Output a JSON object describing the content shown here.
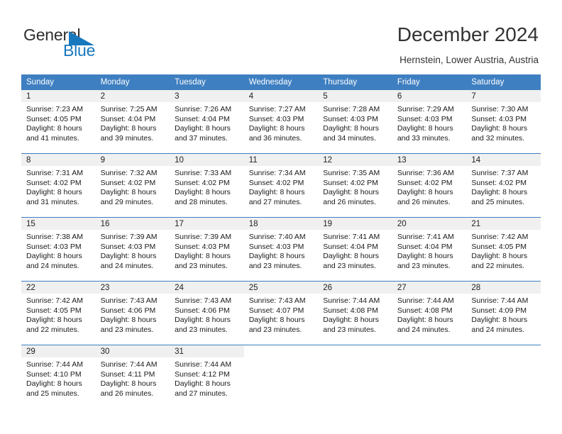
{
  "brand": {
    "name_part1": "General",
    "name_part2": "Blue",
    "triangle_color": "#1878be",
    "text_color": "#2e2e2e"
  },
  "header": {
    "title": "December 2024",
    "subtitle": "Hernstein, Lower Austria, Austria"
  },
  "calendar": {
    "header_bg": "#3e7fc1",
    "header_text_color": "#ffffff",
    "daynum_band_bg": "#f0f0f0",
    "weekday_headers": [
      "Sunday",
      "Monday",
      "Tuesday",
      "Wednesday",
      "Thursday",
      "Friday",
      "Saturday"
    ],
    "weeks": [
      [
        {
          "day": "1",
          "sunrise": "Sunrise: 7:23 AM",
          "sunset": "Sunset: 4:05 PM",
          "daylight_line1": "Daylight: 8 hours",
          "daylight_line2": "and 41 minutes."
        },
        {
          "day": "2",
          "sunrise": "Sunrise: 7:25 AM",
          "sunset": "Sunset: 4:04 PM",
          "daylight_line1": "Daylight: 8 hours",
          "daylight_line2": "and 39 minutes."
        },
        {
          "day": "3",
          "sunrise": "Sunrise: 7:26 AM",
          "sunset": "Sunset: 4:04 PM",
          "daylight_line1": "Daylight: 8 hours",
          "daylight_line2": "and 37 minutes."
        },
        {
          "day": "4",
          "sunrise": "Sunrise: 7:27 AM",
          "sunset": "Sunset: 4:03 PM",
          "daylight_line1": "Daylight: 8 hours",
          "daylight_line2": "and 36 minutes."
        },
        {
          "day": "5",
          "sunrise": "Sunrise: 7:28 AM",
          "sunset": "Sunset: 4:03 PM",
          "daylight_line1": "Daylight: 8 hours",
          "daylight_line2": "and 34 minutes."
        },
        {
          "day": "6",
          "sunrise": "Sunrise: 7:29 AM",
          "sunset": "Sunset: 4:03 PM",
          "daylight_line1": "Daylight: 8 hours",
          "daylight_line2": "and 33 minutes."
        },
        {
          "day": "7",
          "sunrise": "Sunrise: 7:30 AM",
          "sunset": "Sunset: 4:03 PM",
          "daylight_line1": "Daylight: 8 hours",
          "daylight_line2": "and 32 minutes."
        }
      ],
      [
        {
          "day": "8",
          "sunrise": "Sunrise: 7:31 AM",
          "sunset": "Sunset: 4:02 PM",
          "daylight_line1": "Daylight: 8 hours",
          "daylight_line2": "and 31 minutes."
        },
        {
          "day": "9",
          "sunrise": "Sunrise: 7:32 AM",
          "sunset": "Sunset: 4:02 PM",
          "daylight_line1": "Daylight: 8 hours",
          "daylight_line2": "and 29 minutes."
        },
        {
          "day": "10",
          "sunrise": "Sunrise: 7:33 AM",
          "sunset": "Sunset: 4:02 PM",
          "daylight_line1": "Daylight: 8 hours",
          "daylight_line2": "and 28 minutes."
        },
        {
          "day": "11",
          "sunrise": "Sunrise: 7:34 AM",
          "sunset": "Sunset: 4:02 PM",
          "daylight_line1": "Daylight: 8 hours",
          "daylight_line2": "and 27 minutes."
        },
        {
          "day": "12",
          "sunrise": "Sunrise: 7:35 AM",
          "sunset": "Sunset: 4:02 PM",
          "daylight_line1": "Daylight: 8 hours",
          "daylight_line2": "and 26 minutes."
        },
        {
          "day": "13",
          "sunrise": "Sunrise: 7:36 AM",
          "sunset": "Sunset: 4:02 PM",
          "daylight_line1": "Daylight: 8 hours",
          "daylight_line2": "and 26 minutes."
        },
        {
          "day": "14",
          "sunrise": "Sunrise: 7:37 AM",
          "sunset": "Sunset: 4:02 PM",
          "daylight_line1": "Daylight: 8 hours",
          "daylight_line2": "and 25 minutes."
        }
      ],
      [
        {
          "day": "15",
          "sunrise": "Sunrise: 7:38 AM",
          "sunset": "Sunset: 4:03 PM",
          "daylight_line1": "Daylight: 8 hours",
          "daylight_line2": "and 24 minutes."
        },
        {
          "day": "16",
          "sunrise": "Sunrise: 7:39 AM",
          "sunset": "Sunset: 4:03 PM",
          "daylight_line1": "Daylight: 8 hours",
          "daylight_line2": "and 24 minutes."
        },
        {
          "day": "17",
          "sunrise": "Sunrise: 7:39 AM",
          "sunset": "Sunset: 4:03 PM",
          "daylight_line1": "Daylight: 8 hours",
          "daylight_line2": "and 23 minutes."
        },
        {
          "day": "18",
          "sunrise": "Sunrise: 7:40 AM",
          "sunset": "Sunset: 4:03 PM",
          "daylight_line1": "Daylight: 8 hours",
          "daylight_line2": "and 23 minutes."
        },
        {
          "day": "19",
          "sunrise": "Sunrise: 7:41 AM",
          "sunset": "Sunset: 4:04 PM",
          "daylight_line1": "Daylight: 8 hours",
          "daylight_line2": "and 23 minutes."
        },
        {
          "day": "20",
          "sunrise": "Sunrise: 7:41 AM",
          "sunset": "Sunset: 4:04 PM",
          "daylight_line1": "Daylight: 8 hours",
          "daylight_line2": "and 23 minutes."
        },
        {
          "day": "21",
          "sunrise": "Sunrise: 7:42 AM",
          "sunset": "Sunset: 4:05 PM",
          "daylight_line1": "Daylight: 8 hours",
          "daylight_line2": "and 22 minutes."
        }
      ],
      [
        {
          "day": "22",
          "sunrise": "Sunrise: 7:42 AM",
          "sunset": "Sunset: 4:05 PM",
          "daylight_line1": "Daylight: 8 hours",
          "daylight_line2": "and 22 minutes."
        },
        {
          "day": "23",
          "sunrise": "Sunrise: 7:43 AM",
          "sunset": "Sunset: 4:06 PM",
          "daylight_line1": "Daylight: 8 hours",
          "daylight_line2": "and 23 minutes."
        },
        {
          "day": "24",
          "sunrise": "Sunrise: 7:43 AM",
          "sunset": "Sunset: 4:06 PM",
          "daylight_line1": "Daylight: 8 hours",
          "daylight_line2": "and 23 minutes."
        },
        {
          "day": "25",
          "sunrise": "Sunrise: 7:43 AM",
          "sunset": "Sunset: 4:07 PM",
          "daylight_line1": "Daylight: 8 hours",
          "daylight_line2": "and 23 minutes."
        },
        {
          "day": "26",
          "sunrise": "Sunrise: 7:44 AM",
          "sunset": "Sunset: 4:08 PM",
          "daylight_line1": "Daylight: 8 hours",
          "daylight_line2": "and 23 minutes."
        },
        {
          "day": "27",
          "sunrise": "Sunrise: 7:44 AM",
          "sunset": "Sunset: 4:08 PM",
          "daylight_line1": "Daylight: 8 hours",
          "daylight_line2": "and 24 minutes."
        },
        {
          "day": "28",
          "sunrise": "Sunrise: 7:44 AM",
          "sunset": "Sunset: 4:09 PM",
          "daylight_line1": "Daylight: 8 hours",
          "daylight_line2": "and 24 minutes."
        }
      ],
      [
        {
          "day": "29",
          "sunrise": "Sunrise: 7:44 AM",
          "sunset": "Sunset: 4:10 PM",
          "daylight_line1": "Daylight: 8 hours",
          "daylight_line2": "and 25 minutes."
        },
        {
          "day": "30",
          "sunrise": "Sunrise: 7:44 AM",
          "sunset": "Sunset: 4:11 PM",
          "daylight_line1": "Daylight: 8 hours",
          "daylight_line2": "and 26 minutes."
        },
        {
          "day": "31",
          "sunrise": "Sunrise: 7:44 AM",
          "sunset": "Sunset: 4:12 PM",
          "daylight_line1": "Daylight: 8 hours",
          "daylight_line2": "and 27 minutes."
        },
        {
          "day": "",
          "sunrise": "",
          "sunset": "",
          "daylight_line1": "",
          "daylight_line2": ""
        },
        {
          "day": "",
          "sunrise": "",
          "sunset": "",
          "daylight_line1": "",
          "daylight_line2": ""
        },
        {
          "day": "",
          "sunrise": "",
          "sunset": "",
          "daylight_line1": "",
          "daylight_line2": ""
        },
        {
          "day": "",
          "sunrise": "",
          "sunset": "",
          "daylight_line1": "",
          "daylight_line2": ""
        }
      ]
    ]
  }
}
